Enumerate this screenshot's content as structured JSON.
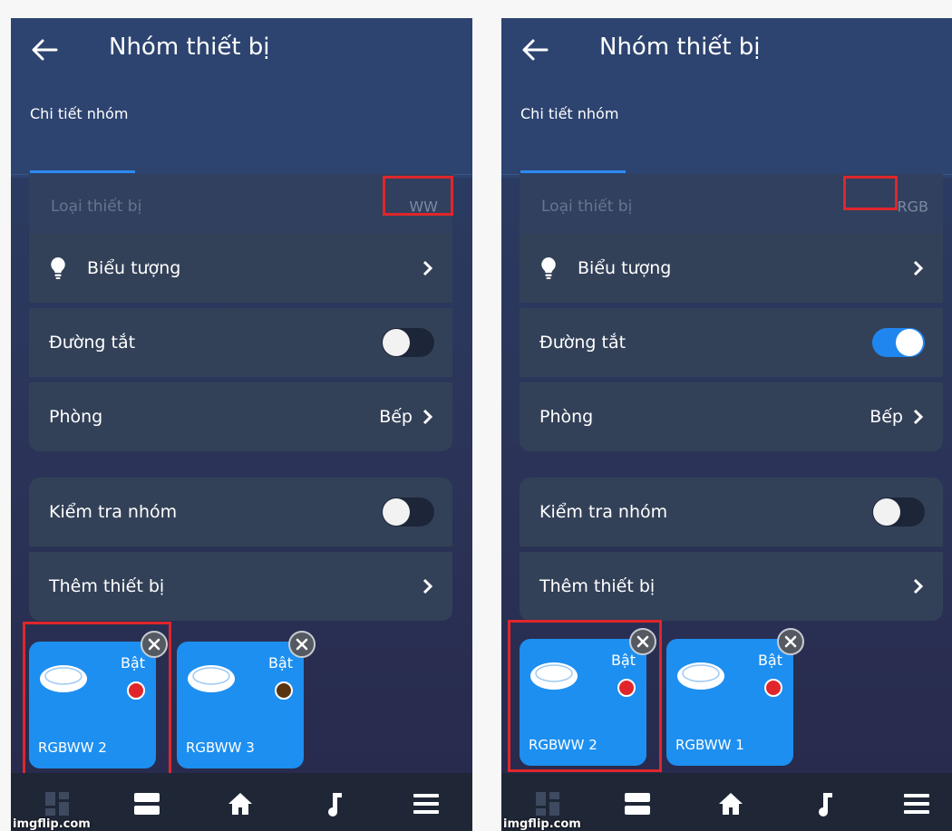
{
  "screens": [
    {
      "title": "Nhóm thiết bị",
      "tab": "Chi tiết nhóm",
      "device_type_label": "Loại thiết bị",
      "device_type_value": "WW",
      "icon_label": "Biểu tượng",
      "shortcut_label": "Đường tắt",
      "shortcut_on": false,
      "room_label": "Phòng",
      "room_value": "Bếp",
      "test_label": "Kiểm tra nhóm",
      "test_on": false,
      "add_label": "Thêm thiết bị",
      "devices": [
        {
          "name": "RGBWW 2",
          "state": "Bật",
          "dot_color": "#e0262b"
        },
        {
          "name": "RGBWW 3",
          "state": "Bật",
          "dot_color": "#5a3410"
        }
      ],
      "watermark": "imgflip.com"
    },
    {
      "title": "Nhóm thiết bị",
      "tab": "Chi tiết nhóm",
      "device_type_label": "Loại thiết bị",
      "device_type_value": "RGB",
      "icon_label": "Biểu tượng",
      "shortcut_label": "Đường tắt",
      "shortcut_on": true,
      "room_label": "Phòng",
      "room_value": "Bếp",
      "test_label": "Kiểm tra nhóm",
      "test_on": false,
      "add_label": "Thêm thiết bị",
      "devices": [
        {
          "name": "RGBWW 2",
          "state": "Bật",
          "dot_color": "#e0262b"
        },
        {
          "name": "RGBWW 1",
          "state": "Bật",
          "dot_color": "#e0262b"
        }
      ],
      "watermark": "imgflip.com"
    }
  ],
  "nav": [
    "dashboard-icon",
    "list-icon",
    "home-icon",
    "music-icon",
    "menu-icon"
  ],
  "colors": {
    "highlight": "#e0262b",
    "accent": "#1d8ff0",
    "toggle_on": "#1f86f0"
  }
}
